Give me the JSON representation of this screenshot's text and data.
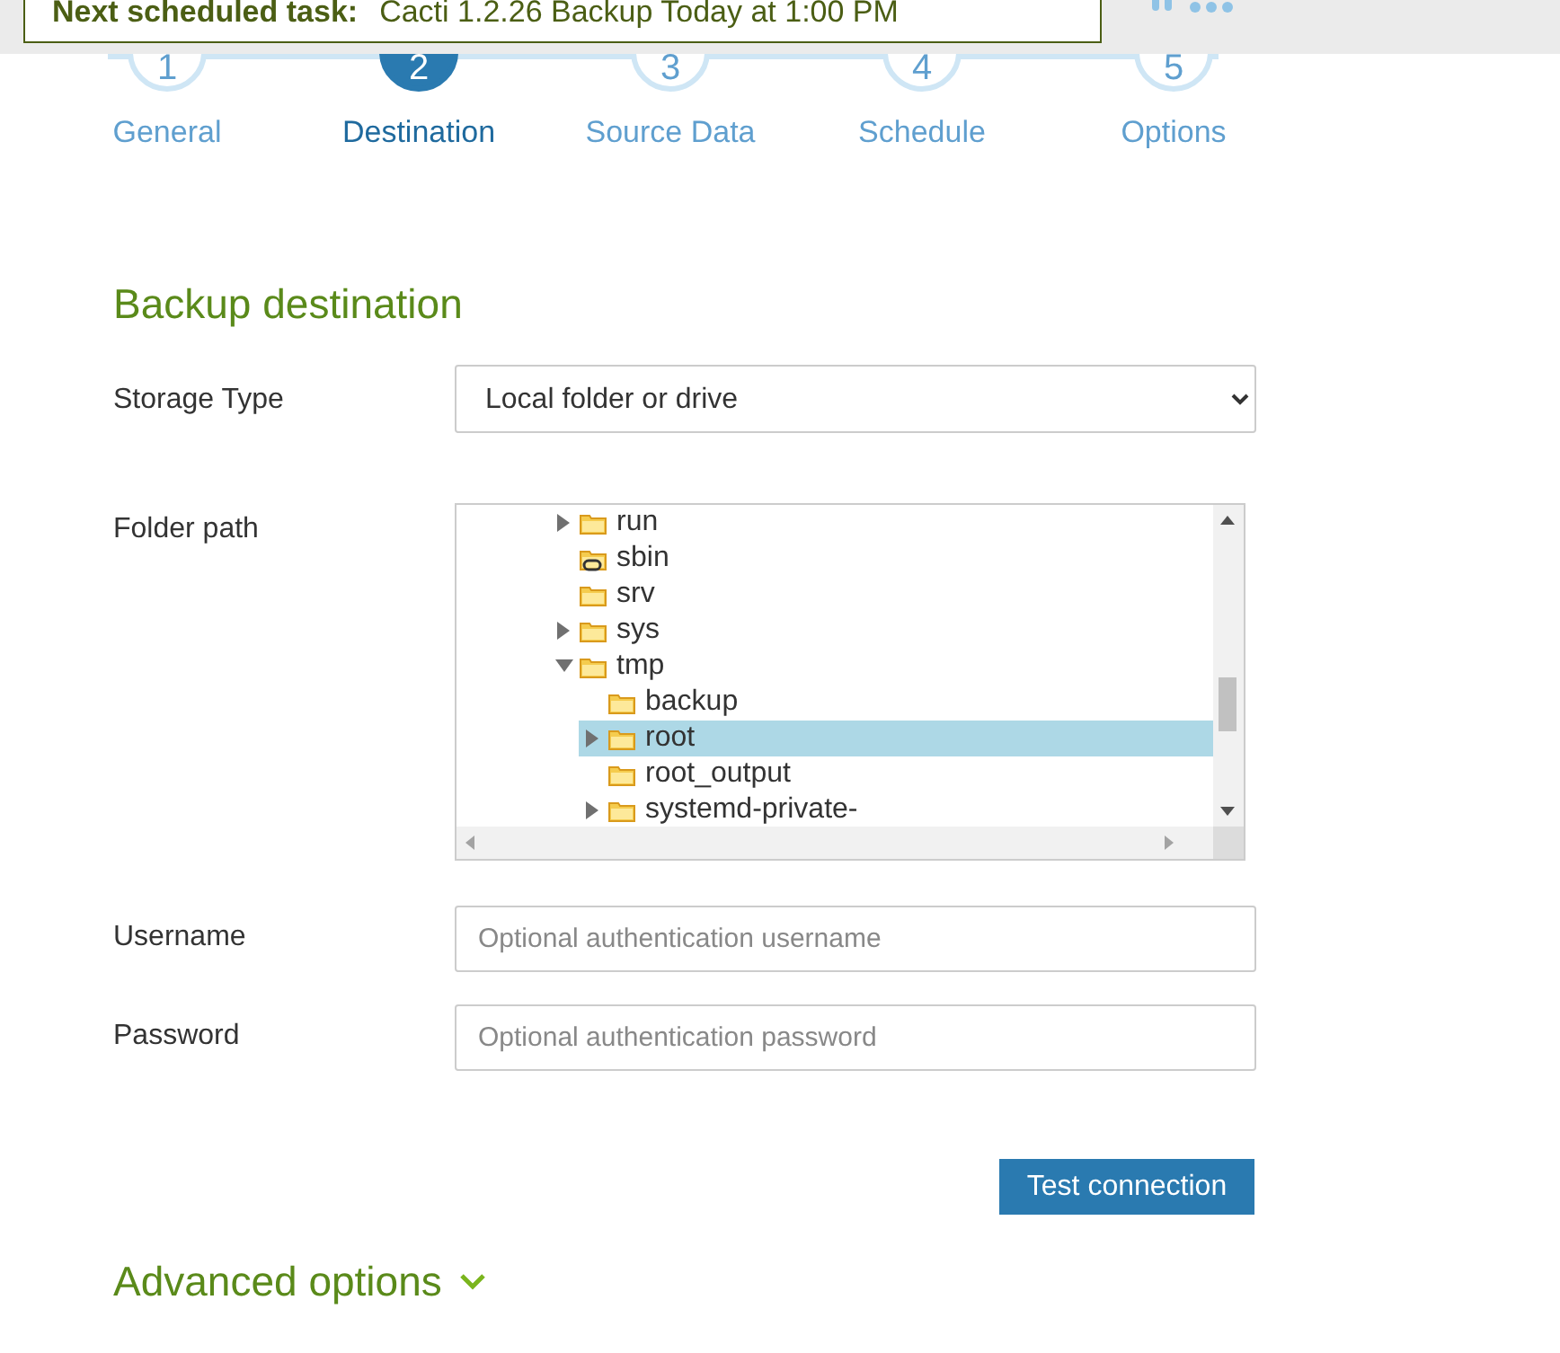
{
  "notice": {
    "label": "Next scheduled task:",
    "text": "Cacti 1.2.26 Backup Today at 1:00 PM"
  },
  "steps": [
    {
      "number": "1",
      "label": "General",
      "selected": false
    },
    {
      "number": "2",
      "label": "Destination",
      "selected": true
    },
    {
      "number": "3",
      "label": "Source Data",
      "selected": false
    },
    {
      "number": "4",
      "label": "Schedule",
      "selected": false
    },
    {
      "number": "5",
      "label": "Options",
      "selected": false
    }
  ],
  "section_title": "Backup destination",
  "storage_type": {
    "label": "Storage Type",
    "value": "Local folder or drive"
  },
  "folder_path": {
    "label": "Folder path",
    "tree": [
      {
        "label": "run",
        "kind": "folder",
        "expandable": true,
        "expanded": false,
        "selected": false
      },
      {
        "label": "sbin",
        "kind": "link-folder",
        "expandable": false,
        "expanded": false,
        "selected": false
      },
      {
        "label": "srv",
        "kind": "folder",
        "expandable": false,
        "expanded": false,
        "selected": false
      },
      {
        "label": "sys",
        "kind": "folder",
        "expandable": true,
        "expanded": false,
        "selected": false
      },
      {
        "label": "tmp",
        "kind": "folder",
        "expandable": true,
        "expanded": true,
        "selected": false,
        "children": [
          {
            "label": "backup",
            "kind": "folder",
            "expandable": false,
            "expanded": false,
            "selected": false
          },
          {
            "label": "root",
            "kind": "folder",
            "expandable": true,
            "expanded": false,
            "selected": true
          },
          {
            "label": "root_output",
            "kind": "folder",
            "expandable": false,
            "expanded": false,
            "selected": false
          },
          {
            "label": "systemd-private-",
            "kind": "folder",
            "expandable": true,
            "expanded": false,
            "selected": false
          }
        ]
      }
    ]
  },
  "username": {
    "label": "Username",
    "placeholder": "Optional authentication username"
  },
  "password": {
    "label": "Password",
    "placeholder": "Optional authentication password"
  },
  "test_button": "Test connection",
  "advanced": {
    "label": "Advanced options",
    "expanded": false
  }
}
